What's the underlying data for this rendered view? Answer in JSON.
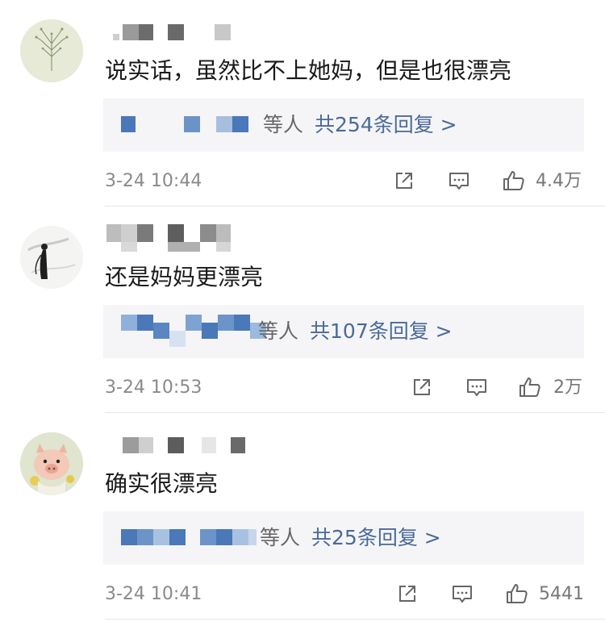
{
  "comments": [
    {
      "text": "说实话，虽然比不上她妈，但是也很漂亮",
      "reply_suffix": "等人",
      "reply_total": "共254条回复 >",
      "time": "3-24 10:44",
      "likes": "4.4万",
      "icons": [
        "share-icon",
        "comment-icon",
        "thumbs-up-icon"
      ]
    },
    {
      "text": "还是妈妈更漂亮",
      "reply_suffix": "等人",
      "reply_total": "共107条回复 >",
      "time": "3-24 10:53",
      "likes": "2万",
      "icons": [
        "share-icon",
        "comment-icon",
        "thumbs-up-icon"
      ]
    },
    {
      "text": "确实很漂亮",
      "reply_suffix": "等人",
      "reply_total": "共25条回复 >",
      "time": "3-24 10:41",
      "likes": "5441",
      "icons": [
        "share-icon",
        "comment-icon",
        "thumbs-up-icon"
      ]
    }
  ],
  "colors": {
    "link": "#4a6a99",
    "meta": "#8a8a8a",
    "reply_bg": "#f5f5f7",
    "mosaic_blue": "#4a78b8",
    "mosaic_gray": "#6a6a6a"
  }
}
